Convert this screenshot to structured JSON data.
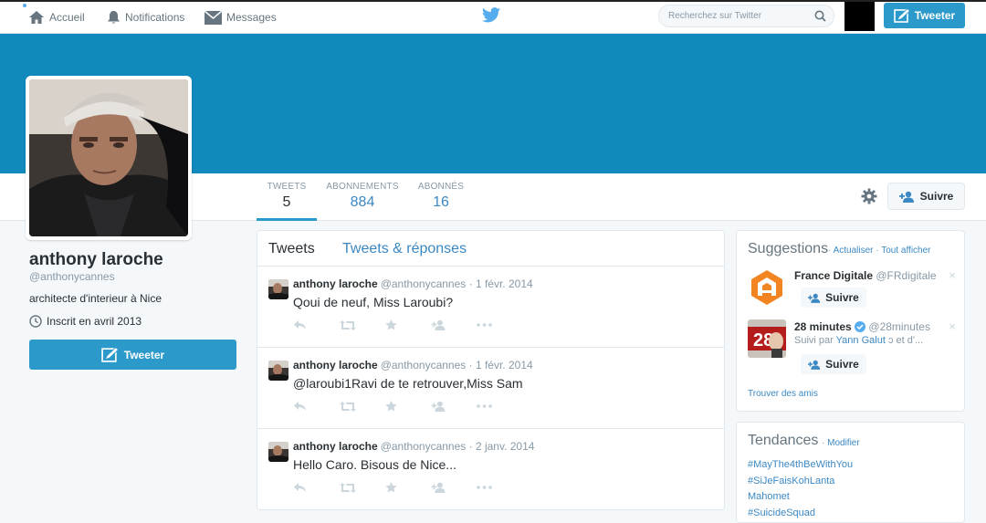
{
  "nav": {
    "home": "Accueil",
    "notifications": "Notifications",
    "messages": "Messages",
    "search_placeholder": "Recherchez sur Twitter",
    "tweet_button": "Tweeter"
  },
  "profile": {
    "name": "anthony laroche",
    "handle": "@anthonycannes",
    "bio": "architecte d'interieur à Nice",
    "joined": "Inscrit en avril 2013",
    "tweet_button": "Tweeter",
    "follow_button": "Suivre",
    "stats": [
      {
        "label": "TWEETS",
        "value": "5"
      },
      {
        "label": "ABONNEMENTS",
        "value": "884"
      },
      {
        "label": "ABONNÉS",
        "value": "16"
      }
    ]
  },
  "timeline": {
    "tabs": [
      "Tweets",
      "Tweets & réponses"
    ],
    "tweets": [
      {
        "name": "anthony laroche",
        "handle": "@anthonycannes",
        "date": "· 1 févr. 2014",
        "text": "Qoui de neuf, Miss Laroubi?"
      },
      {
        "name": "anthony laroche",
        "handle": "@anthonycannes",
        "date": "· 1 févr. 2014",
        "text": "@laroubi1Ravi de te retrouver,Miss Sam"
      },
      {
        "name": "anthony laroche",
        "handle": "@anthonycannes",
        "date": "· 2 janv. 2014",
        "text": "Hello Caro. Bisous de Nice..."
      }
    ]
  },
  "suggestions": {
    "title": "Suggestions",
    "refresh": "Actualiser",
    "separator": "·",
    "view_all": "Tout afficher",
    "items": [
      {
        "name": "France Digitale",
        "handle": "@FRdigitale",
        "follow": "Suivre",
        "close": "×"
      },
      {
        "name": "28 minutes",
        "handle": "@28minutes",
        "followed_by": "Suivi par",
        "followed_name": "Yann Galut",
        "followed_more": "ↄ et d'...",
        "follow": "Suivre",
        "close": "×",
        "logo_text": "28"
      }
    ],
    "find_friends": "Trouver des amis"
  },
  "trends": {
    "title": "Tendances",
    "modify": "Modifier",
    "items": [
      "#MayThe4thBeWithYou",
      "#SiJeFaisKohLanta",
      "Mahomet",
      "#SuicideSquad"
    ]
  },
  "colors": {
    "banner": "#1089bd",
    "accent": "#2b9acb",
    "link": "#3b88c3"
  }
}
